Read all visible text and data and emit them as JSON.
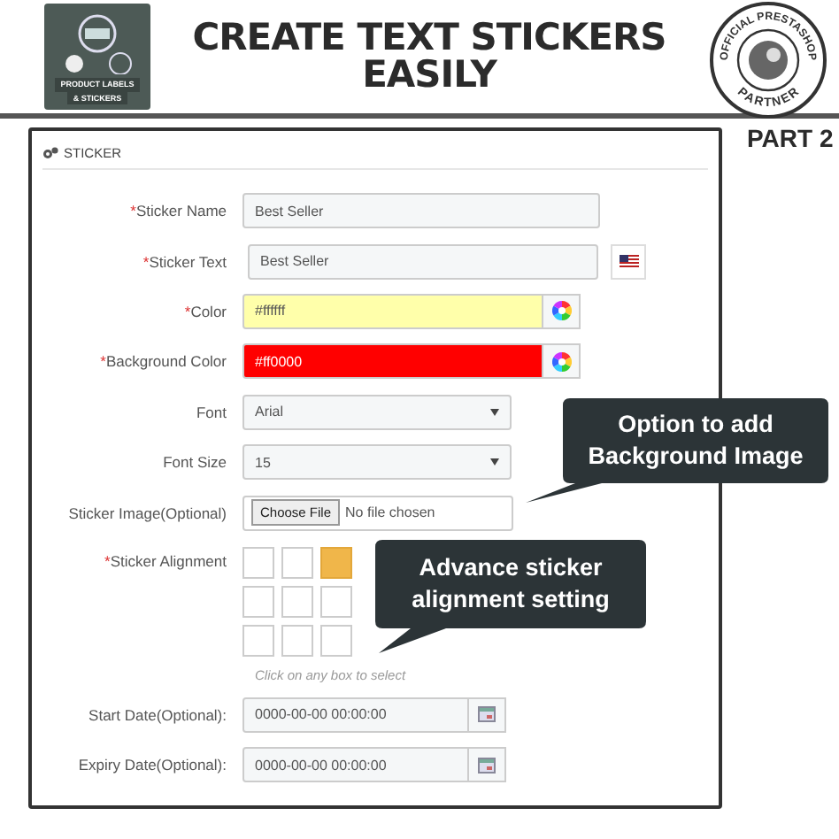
{
  "header": {
    "logo_text": [
      "PRODUCT LABELS",
      "& STICKERS"
    ],
    "title_lines": [
      "CREATE TEXT STICKERS",
      "EASILY"
    ],
    "badge": {
      "top": "OFFICIAL PRESTASHOP",
      "bottom": "PARTNER"
    },
    "part_label": "PART 2"
  },
  "panel": {
    "title": "STICKER",
    "fields": [
      {
        "kind": "text",
        "mark": "*",
        "label": "Sticker Name",
        "value": "Best Seller"
      },
      {
        "kind": "text-flag",
        "mark": "*",
        "label": "Sticker Text",
        "value": "Best Seller"
      },
      {
        "kind": "color",
        "mark": "*",
        "label": "Color",
        "value": "#ffffff",
        "color": "#ffffaa"
      },
      {
        "kind": "color",
        "mark": "*",
        "label": "Background Color",
        "value": "#ff0000",
        "color": "#ff0000"
      },
      {
        "kind": "select",
        "label": "Font",
        "value": "Arial"
      },
      {
        "kind": "select",
        "label": "Font Size",
        "value": "15"
      },
      {
        "kind": "file",
        "label": "Sticker Image(Optional)",
        "button": "Choose File",
        "value": "No file chosen"
      },
      {
        "kind": "grid",
        "mark": "*",
        "label": "Sticker Alignment",
        "cells": [
          {
            "selected": false
          },
          {
            "selected": false
          },
          {
            "selected": true
          },
          {
            "selected": false
          },
          {
            "selected": false
          },
          {
            "selected": false
          },
          {
            "selected": false
          },
          {
            "selected": false
          },
          {
            "selected": false
          }
        ],
        "hint": "Click on any box to select"
      },
      {
        "kind": "date",
        "label": "Start Date(Optional):",
        "value": "0000-00-00 00:00:00"
      },
      {
        "kind": "date",
        "label": "Expiry Date(Optional):",
        "value": "0000-00-00 00:00:00"
      }
    ]
  },
  "callouts": [
    {
      "text": "Option to add Background Image"
    },
    {
      "text": "Advance sticker alignment setting"
    }
  ]
}
